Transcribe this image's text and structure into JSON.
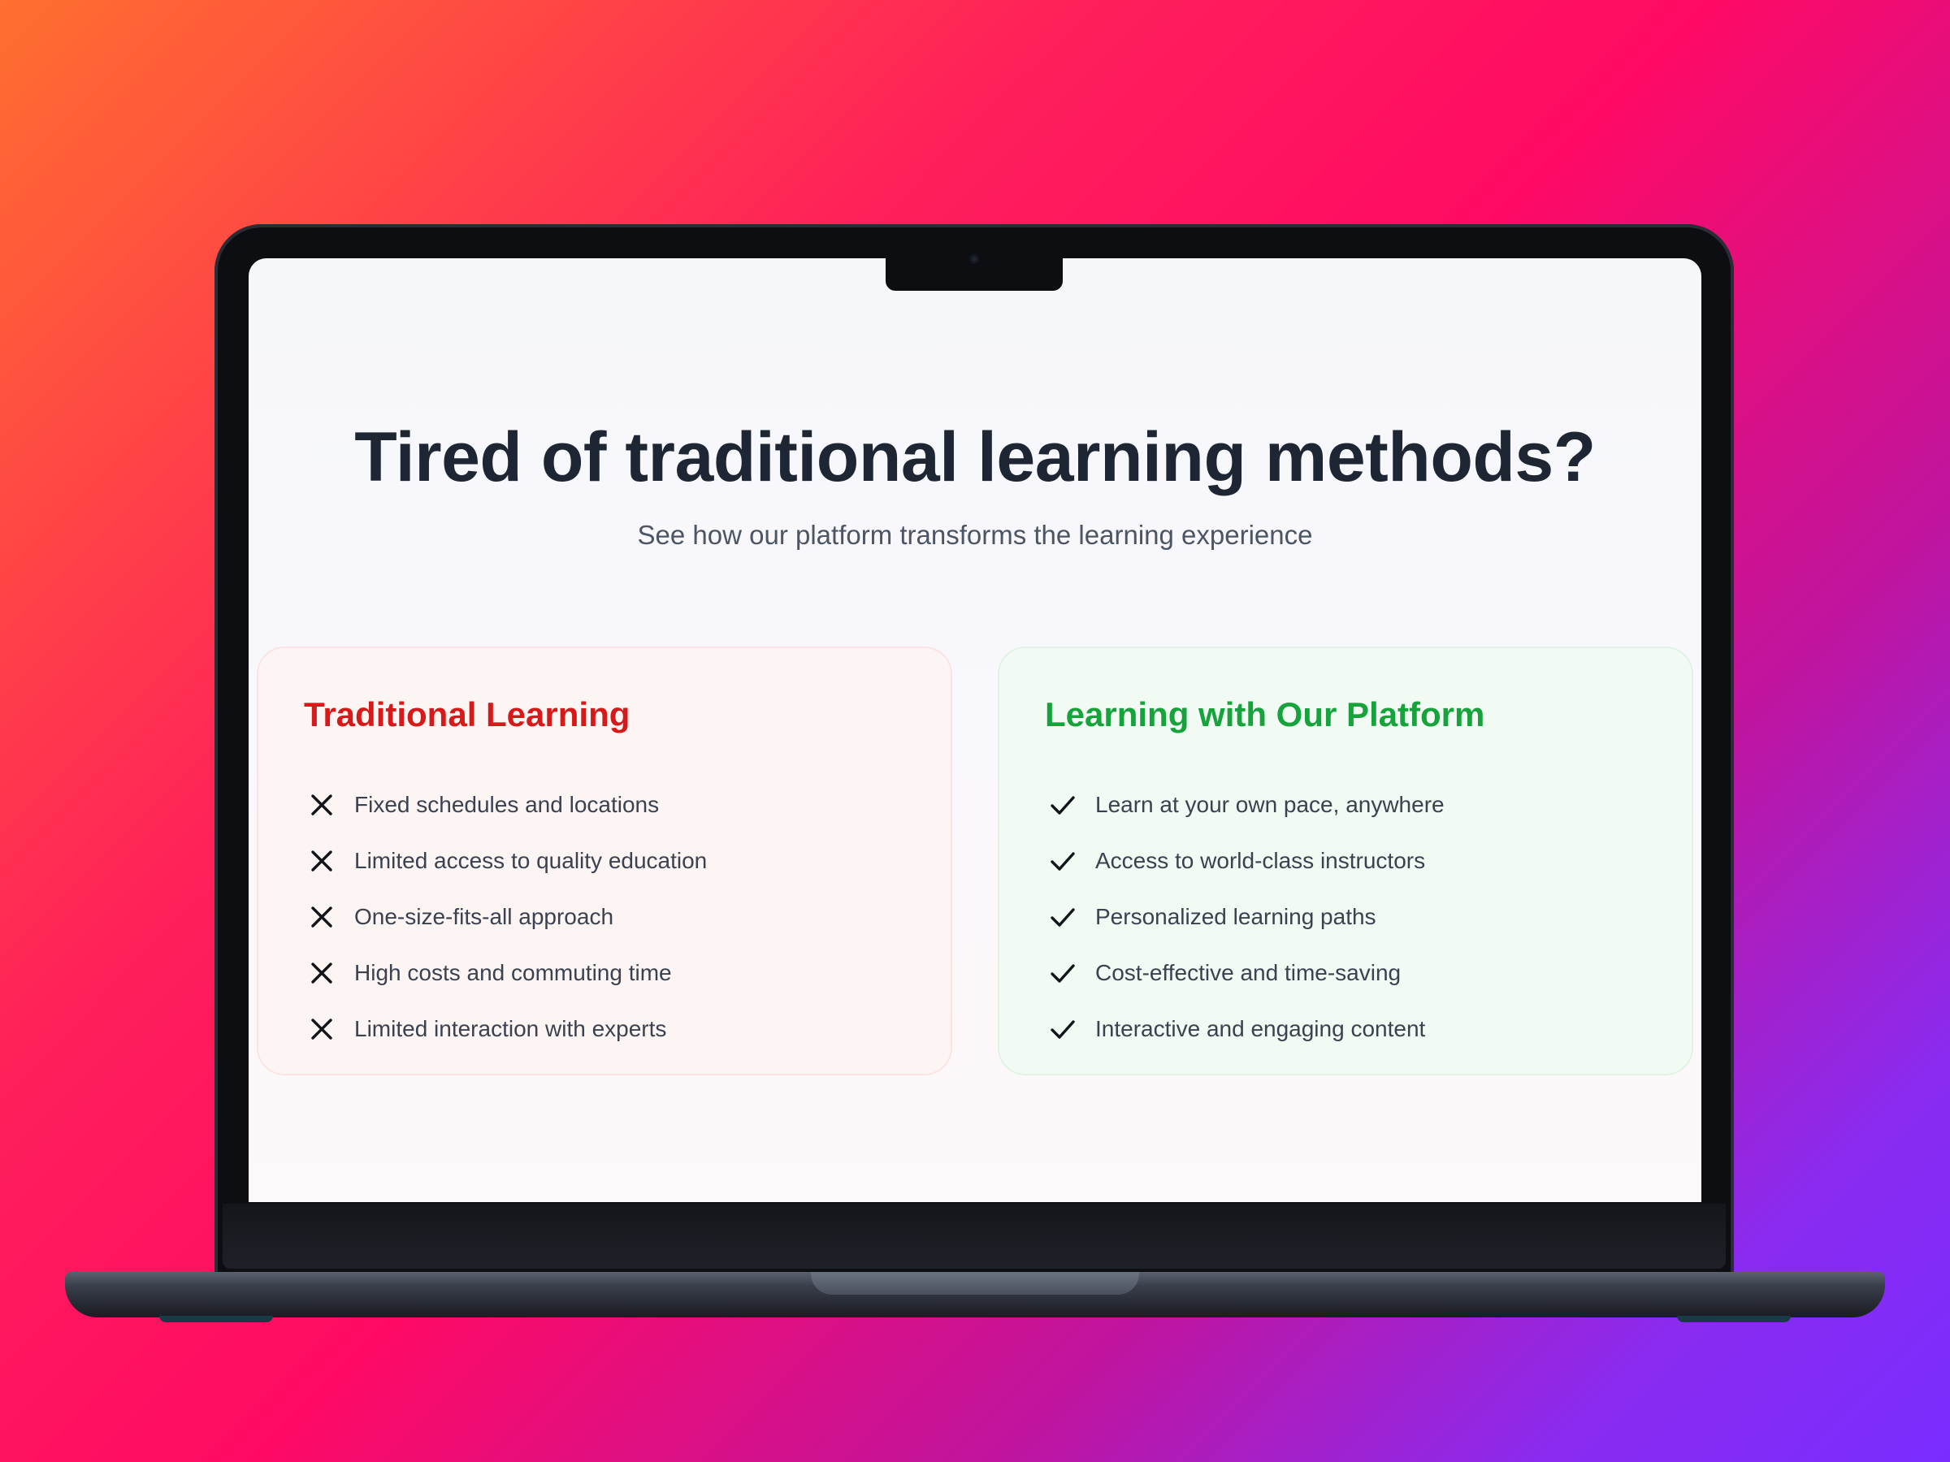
{
  "hero": {
    "title": "Tired of traditional learning methods?",
    "subtitle": "See how our platform transforms the learning experience"
  },
  "traditional": {
    "title": "Traditional Learning",
    "accent_color": "#d61a1a",
    "icon": "x-icon",
    "items": [
      "Fixed schedules and locations",
      "Limited access to quality education",
      "One-size-fits-all approach",
      "High costs and commuting time",
      "Limited interaction with experts"
    ]
  },
  "platform": {
    "title": "Learning with Our Platform",
    "accent_color": "#17a33b",
    "icon": "check-icon",
    "items": [
      "Learn at your own pace, anywhere",
      "Access to world-class instructors",
      "Personalized learning paths",
      "Cost-effective and time-saving",
      "Interactive and engaging content"
    ]
  }
}
